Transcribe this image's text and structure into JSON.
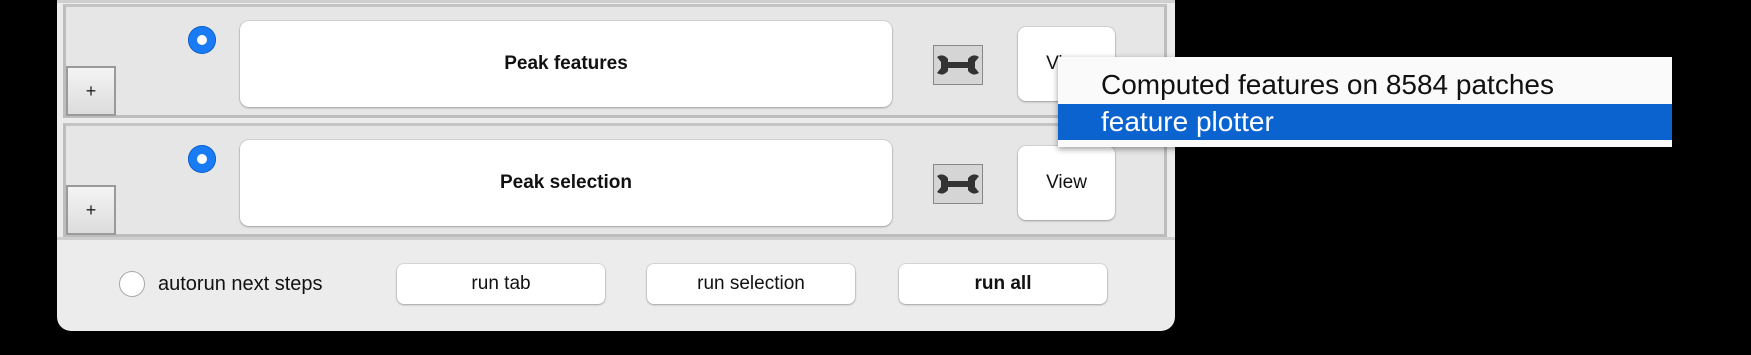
{
  "steps": [
    {
      "label": "Peak features",
      "view_label": "View",
      "expand_label": "+"
    },
    {
      "label": "Peak selection",
      "view_label": "View",
      "expand_label": "+"
    }
  ],
  "bottom_bar": {
    "autorun_label": "autorun next steps",
    "run_tab_label": "run tab",
    "run_selection_label": "run selection",
    "run_all_label": "run all"
  },
  "popup_menu": {
    "items": [
      {
        "label": "Computed features on 8584 patches",
        "selected": false
      },
      {
        "label": "feature plotter",
        "selected": true
      }
    ]
  },
  "colors": {
    "accent": "#1a7cf4",
    "menu_selection": "#0a63cf",
    "panel_background": "#ececec"
  }
}
